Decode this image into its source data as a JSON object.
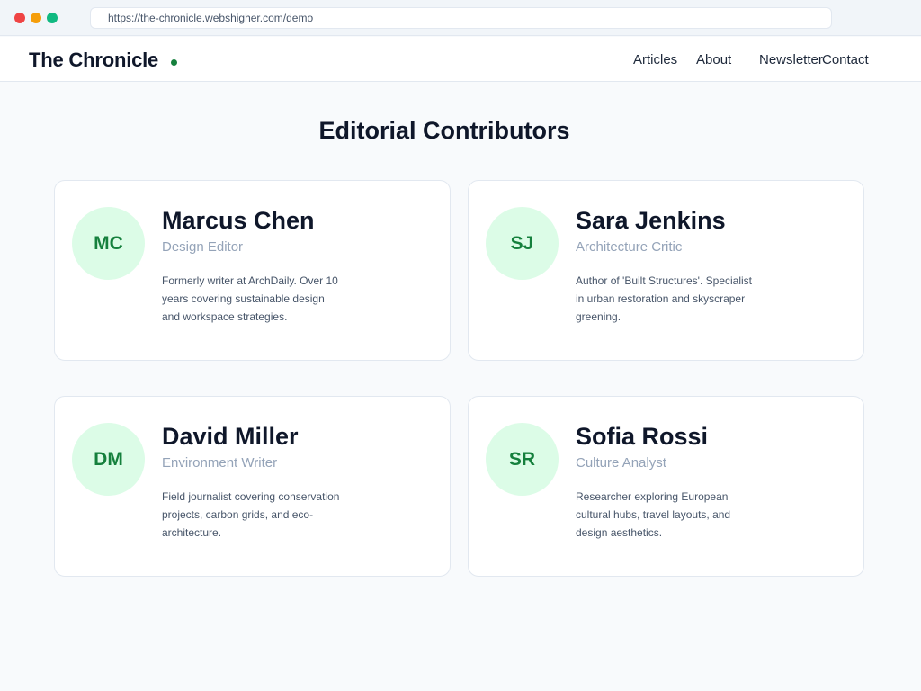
{
  "browser": {
    "url": "https://the-chronicle.webshigher.com/demo"
  },
  "site": {
    "brand": "The Chronicle",
    "nav": [
      "Articles",
      "About",
      "Newsletter",
      "Contact"
    ]
  },
  "main": {
    "title": "Editorial Contributors",
    "contributors": [
      {
        "initials": "MC",
        "name": "Marcus Chen",
        "role": "Design Editor",
        "bio": "Formerly writer at ArchDaily. Over 10 years covering sustainable design and workspace strategies."
      },
      {
        "initials": "SJ",
        "name": "Sara Jenkins",
        "role": "Architecture Critic",
        "bio": "Author of 'Built Structures'. Specialist in urban restoration and skyscraper greening."
      },
      {
        "initials": "DM",
        "name": "David Miller",
        "role": "Environment Writer",
        "bio": "Field journalist covering conservation projects, carbon grids, and eco-architecture."
      },
      {
        "initials": "SR",
        "name": "Sofia Rossi",
        "role": "Culture Analyst",
        "bio": "Researcher exploring European cultural hubs, travel layouts, and design aesthetics."
      }
    ]
  },
  "colors": {
    "accent": "#15803d",
    "avatar_bg": "#dcfce7",
    "page_bg": "#f8fafc"
  }
}
